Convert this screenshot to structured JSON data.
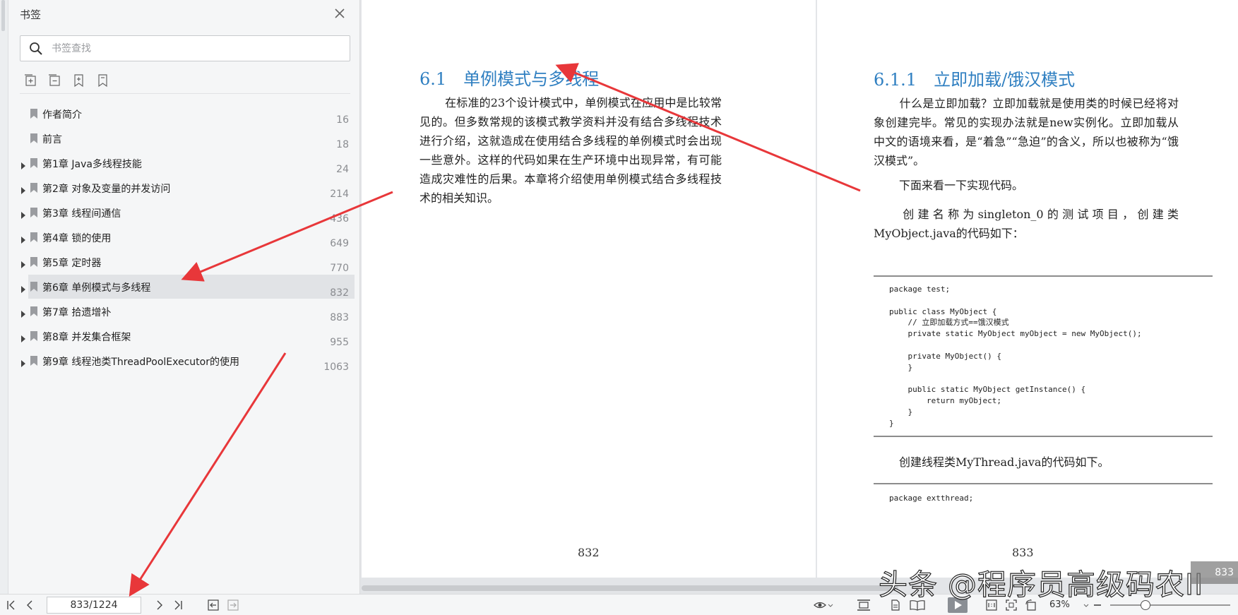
{
  "sidebar": {
    "title": "书签",
    "search_placeholder": "书签查找",
    "bookmarks": [
      {
        "label": "作者简介",
        "page": "16"
      },
      {
        "label": "前言",
        "page": "18"
      },
      {
        "label": "第1章 Java多线程技能",
        "page": "24"
      },
      {
        "label": "第2章 对象及变量的并发访问",
        "page": "214"
      },
      {
        "label": "第3章 线程间通信",
        "page": "436"
      },
      {
        "label": "第4章 锁的使用",
        "page": "649"
      },
      {
        "label": "第5章 定时器",
        "page": "770"
      },
      {
        "label": "第6章 单例模式与多线程",
        "page": "832"
      },
      {
        "label": "第7章 拾遗增补",
        "page": "883"
      },
      {
        "label": "第8章 并发集合框架",
        "page": "955"
      },
      {
        "label": "第9章 线程池类ThreadPoolExecutor的使用",
        "page": "1063"
      }
    ],
    "selected_index": 7
  },
  "left_page": {
    "heading": "6.1　单例模式与多线程",
    "paragraph": "在标准的23个设计模式中，单例模式在应用中是比较常见的。但多数常规的该模式教学资料并没有结合多线程技术进行介绍，这就造成在使用结合多线程的单例模式时会出现一些意外。这样的代码如果在生产环境中出现异常，有可能造成灾难性的后果。本章将介绍使用单例模式结合多线程技术的相关知识。",
    "page_number": "832"
  },
  "right_page": {
    "heading": "6.1.1　立即加载/饿汉模式",
    "para1": "什么是立即加载？立即加载就是使用类的时候已经将对象创建完毕。常见的实现办法就是new实例化。立即加载从中文的语境来看，是“着急”“急迫”的含义，所以也被称为“饿汉模式”。",
    "para2": "下面来看一下实现代码。",
    "para3": "创建名称为singleton_0的测试项目，创建类MyObject.java的代码如下：",
    "code1": "package test;\n\npublic class MyObject {\n    // 立即加载方式==饿汉模式\n    private static MyObject myObject = new MyObject();\n\n    private MyObject() {\n    }\n\n    public static MyObject getInstance() {\n        return myObject;\n    }\n}",
    "para4": "创建线程类MyThread.java的代码如下。",
    "code2": "package extthread;",
    "page_number": "833"
  },
  "bottombar": {
    "page_value": "833/1224",
    "zoom": "63%"
  },
  "overlay": {
    "watermark": "头条 @程序员高级码农II",
    "page_badge": "833"
  },
  "colors": {
    "heading": "#2f7fc1",
    "arrow": "#e8373a",
    "selected_row": "#e1e3e6"
  }
}
